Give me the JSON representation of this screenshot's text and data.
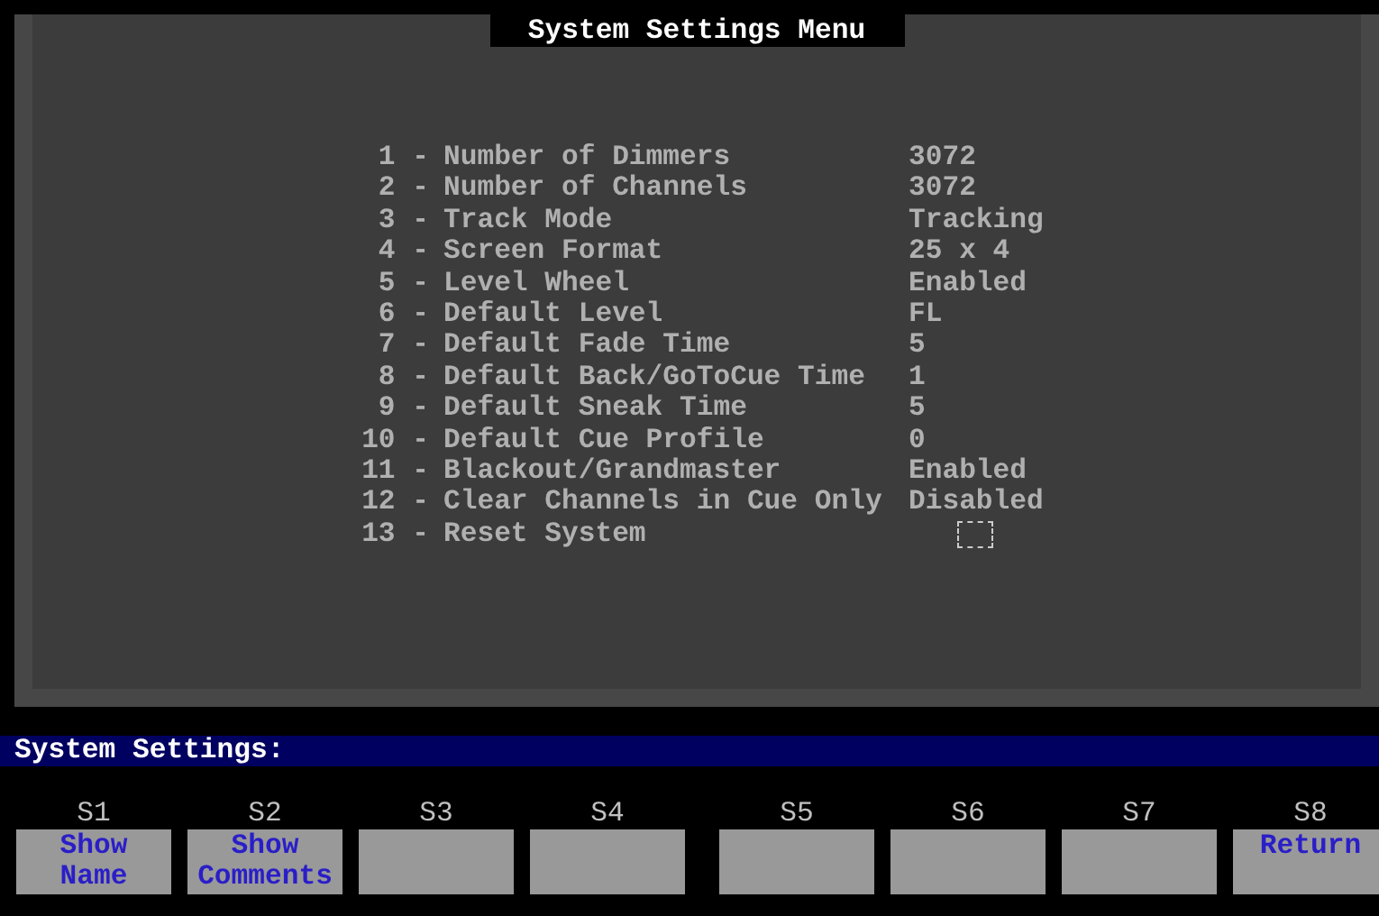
{
  "window": {
    "title": "System Settings Menu"
  },
  "menu": [
    {
      "number": "1 -",
      "label": "Number of Dimmers",
      "value": "3072",
      "kind": "setting"
    },
    {
      "number": "2 -",
      "label": "Number of Channels",
      "value": "3072",
      "kind": "setting"
    },
    {
      "number": "3 -",
      "label": "Track Mode",
      "value": "Tracking",
      "kind": "setting"
    },
    {
      "number": "4 -",
      "label": "Screen Format",
      "value": "25 x 4",
      "kind": "setting"
    },
    {
      "number": "5 -",
      "label": "Level Wheel",
      "value": "Enabled",
      "kind": "setting"
    },
    {
      "number": "6 -",
      "label": "Default Level",
      "value": "FL",
      "kind": "setting"
    },
    {
      "number": "7 -",
      "label": "Default Fade Time",
      "value": "5",
      "kind": "setting"
    },
    {
      "number": "8 -",
      "label": "Default Back/GoToCue Time",
      "value": "1",
      "kind": "setting"
    },
    {
      "number": "9 -",
      "label": "Default Sneak Time",
      "value": "5",
      "kind": "setting"
    },
    {
      "number": "10 -",
      "label": "Default Cue Profile",
      "value": "0",
      "kind": "setting"
    },
    {
      "number": "11 -",
      "label": "Blackout/Grandmaster",
      "value": "Enabled",
      "kind": "setting"
    },
    {
      "number": "12 -",
      "label": "Clear Channels in Cue Only",
      "value": "Disabled",
      "kind": "setting"
    },
    {
      "number": "13 -",
      "label": "Reset System",
      "kind": "action"
    }
  ],
  "command_line": "System Settings:",
  "softkeys": [
    {
      "key": "S1",
      "label": "Show Name"
    },
    {
      "key": "S2",
      "label": "Show Comments"
    },
    {
      "key": "S3"
    },
    {
      "key": "S4"
    },
    {
      "key": "S5"
    },
    {
      "key": "S6"
    },
    {
      "key": "S7"
    },
    {
      "key": "S8",
      "label": "Return"
    }
  ]
}
